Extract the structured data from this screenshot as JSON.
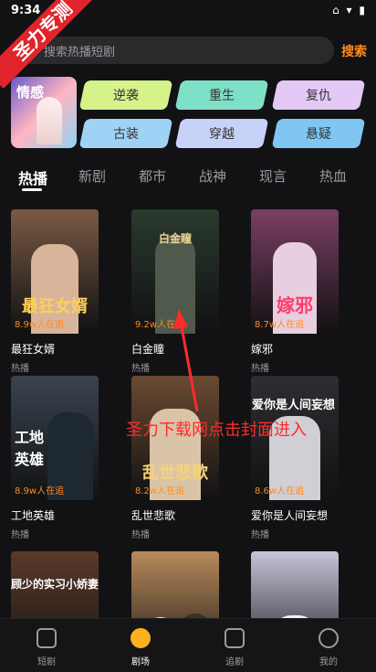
{
  "status_bar": {
    "time": "9:34",
    "icons": "⌂ ▾ ▮"
  },
  "watermark": {
    "banner": "圣力专测",
    "overlay_text": "圣力下载网点击封面进入"
  },
  "search": {
    "placeholder": "搜索热播短剧",
    "button": "搜索"
  },
  "hero": {
    "label": "情感"
  },
  "categories": [
    {
      "label": "逆袭",
      "color": "#d6f28a"
    },
    {
      "label": "重生",
      "color": "#7ee0c7"
    },
    {
      "label": "复仇",
      "color": "#e4c9f7"
    },
    {
      "label": "古装",
      "color": "#9fd3f5"
    },
    {
      "label": "穿越",
      "color": "#c7d2f8"
    },
    {
      "label": "悬疑",
      "color": "#7fc7f2"
    }
  ],
  "tabs": [
    "热播",
    "新剧",
    "都市",
    "战神",
    "现言",
    "热血"
  ],
  "dramas": [
    {
      "name": "最狂女婿",
      "tag": "热播",
      "poster_title": "最狂女婿",
      "heat": "8.9w人在追",
      "color": "#7a5a45"
    },
    {
      "name": "白金瞳",
      "tag": "热播",
      "poster_title": "白金瞳",
      "heat": "9.2w人在追",
      "color": "#2a3a2e"
    },
    {
      "name": "嫁邪",
      "tag": "热播",
      "poster_title": "嫁邪",
      "heat": "8.7w人在追",
      "color": "#7a3f64"
    },
    {
      "name": "工地英雄",
      "tag": "热播",
      "poster_title": "工地英雄",
      "heat": "8.9w人在追",
      "color": "#3a4450"
    },
    {
      "name": "乱世悲歌",
      "tag": "热播",
      "poster_title": "乱世悲歌",
      "heat": "8.2w人在追",
      "color": "#6b4a32"
    },
    {
      "name": "爱你是人间妄想",
      "tag": "热播",
      "poster_title": "爱你是人间妄想",
      "heat": "8.6w人在追",
      "color": "#2e2e33"
    },
    {
      "name": "",
      "tag": "",
      "poster_title": "顾少的实习小娇妻",
      "heat": "",
      "color": "#5a3a2a"
    },
    {
      "name": "",
      "tag": "",
      "poster_title": "",
      "heat": "",
      "color": "#b88a5a"
    },
    {
      "name": "",
      "tag": "",
      "poster_title": "",
      "heat": "",
      "color": "#c7c3d9"
    }
  ],
  "nav": [
    {
      "label": "短剧",
      "icon": "home-icon"
    },
    {
      "label": "剧场",
      "icon": "theater-icon"
    },
    {
      "label": "追剧",
      "icon": "video-icon"
    },
    {
      "label": "我的",
      "icon": "profile-icon"
    }
  ],
  "accent_color": "#ff8a1f"
}
